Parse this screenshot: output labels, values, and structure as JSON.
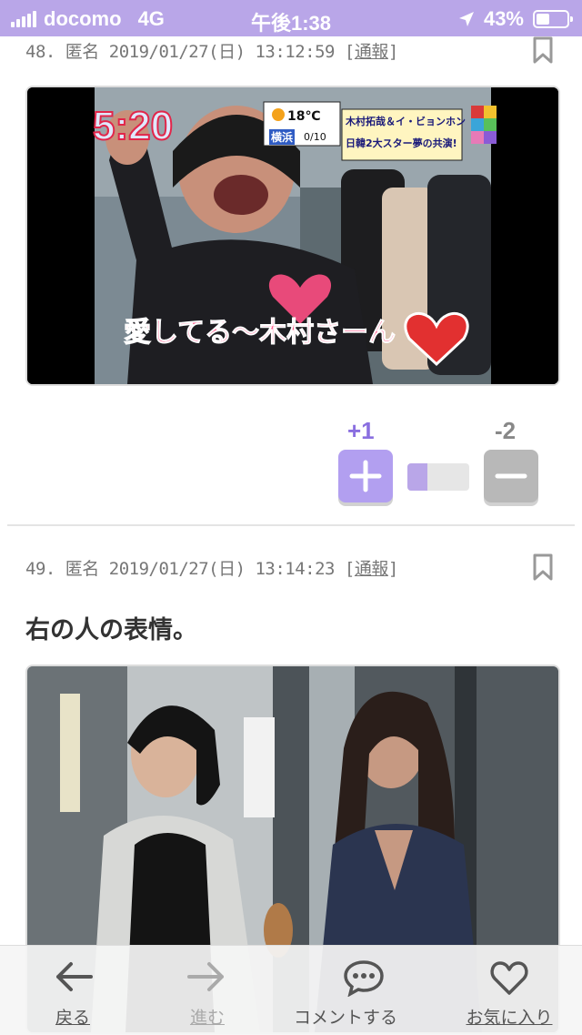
{
  "status_bar": {
    "carrier": "docomo",
    "network": "4G",
    "time": "午後1:38",
    "battery": "43%"
  },
  "posts": [
    {
      "number": "48.",
      "author": "匿名",
      "timestamp": "2019/01/27(日) 13:12:59",
      "report_open": "[",
      "report": "通報",
      "report_close": "]",
      "image": {
        "clock": "5:20",
        "temp": "18℃",
        "location": "横浜",
        "rain": "0/10",
        "headline_1": "木村拓哉＆イ・ビョンホン",
        "headline_2": "日韓2大スター夢の共演!",
        "caption": "愛してる〜木村さーん"
      },
      "votes": {
        "plus": "+1",
        "minus": "-2",
        "ratio": 0.33
      }
    },
    {
      "number": "49.",
      "author": "匿名",
      "timestamp": "2019/01/27(日) 13:14:23",
      "report_open": "[",
      "report": "通報",
      "report_close": "]",
      "text": "右の人の表情。"
    }
  ],
  "tab_bar": {
    "back": "戻る",
    "forward": "進む",
    "comment": "コメントする",
    "favorite": "お気に入り"
  },
  "colors": {
    "accent": "#b9a6e8",
    "plus_button": "#b29ff0",
    "minus_button": "#b8b8b8",
    "plus_text": "#8a6fe0",
    "minus_text": "#888888"
  }
}
